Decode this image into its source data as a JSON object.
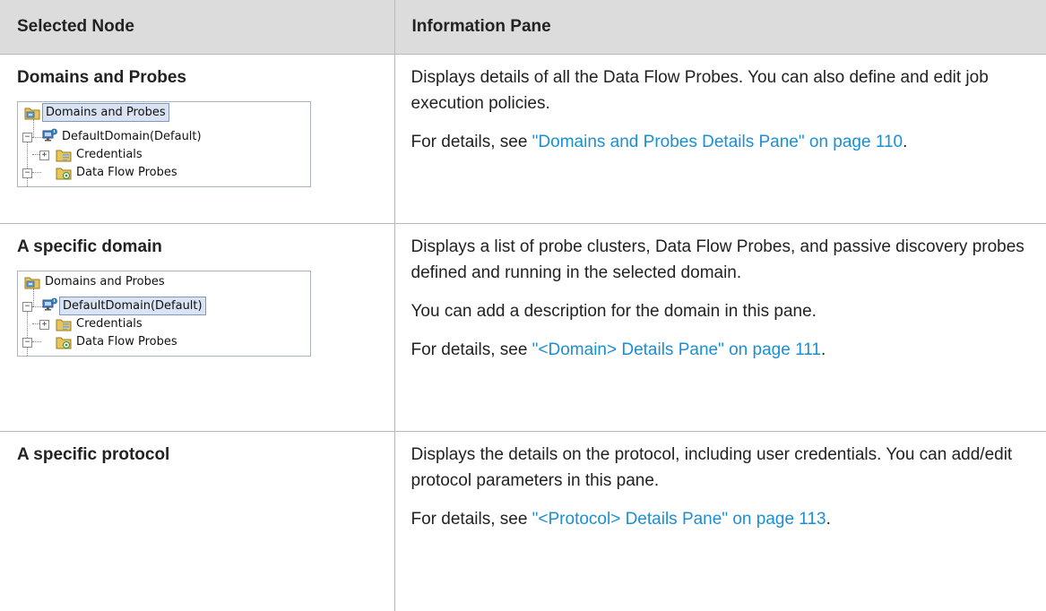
{
  "table": {
    "headers": [
      "Selected Node",
      "Information Pane"
    ],
    "rows": [
      {
        "node": "Domains and Probes",
        "tree": {
          "root": "Domains and Probes",
          "domain": "DefaultDomain(Default)",
          "credentials": "Credentials",
          "probes": "Data Flow Probes",
          "selected": "root"
        },
        "desc_1": "Displays details of all the Data Flow Probes. You can also define and edit job execution policies.",
        "details_prefix": "For details, see ",
        "details_link": "\"Domains and Probes Details Pane\" on page 110",
        "details_suffix": "."
      },
      {
        "node": "A specific domain",
        "tree": {
          "root": "Domains and Probes",
          "domain": "DefaultDomain(Default)",
          "credentials": "Credentials",
          "probes": "Data Flow Probes",
          "selected": "domain"
        },
        "desc_1": "Displays a list of probe clusters, Data Flow Probes, and passive discovery probes defined and running in the selected domain.",
        "desc_2": "You can add a description for the domain in this pane.",
        "details_prefix": "For details, see ",
        "details_link": "\"<Domain> Details Pane\" on page 111",
        "details_suffix": "."
      },
      {
        "node": "A specific protocol",
        "desc_1": "Displays the details on the protocol, including user credentials. You can add/edit protocol parameters in this pane.",
        "details_prefix": "For details, see ",
        "details_link": "\"<Protocol> Details Pane\" on page 113",
        "details_suffix": "."
      }
    ]
  },
  "icons": {
    "root": "domains-probes-folder-icon",
    "domain": "domain-computer-icon",
    "credentials": "credentials-folder-icon",
    "probes": "probes-folder-icon"
  },
  "colors": {
    "header_bg": "#dcdcdc",
    "link": "#1a8fd6",
    "selection_bg": "#d9e3f2",
    "selection_border": "#7f97c2"
  }
}
